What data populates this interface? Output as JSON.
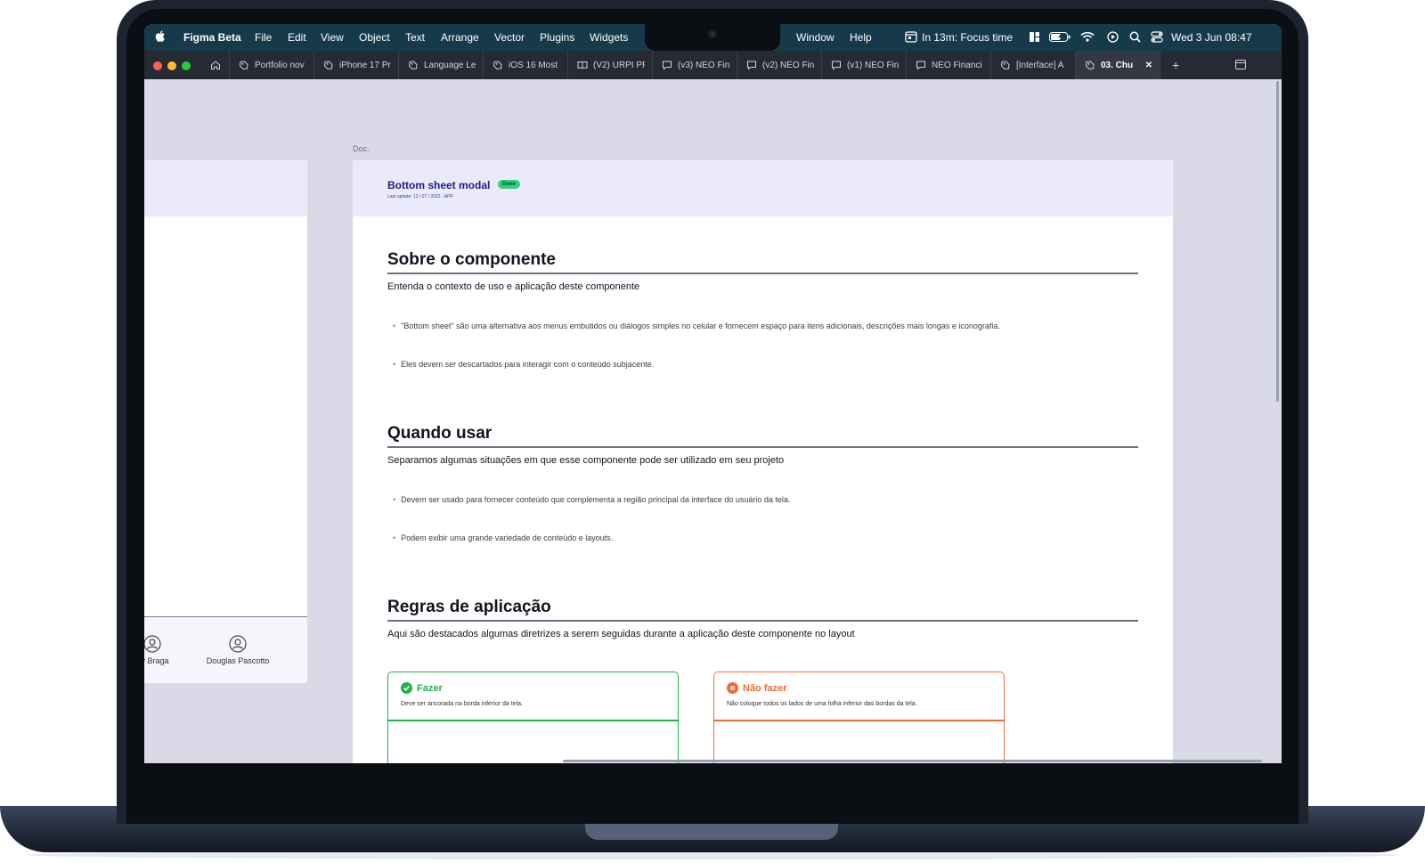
{
  "menubar": {
    "app_name": "Figma Beta",
    "items": [
      "File",
      "Edit",
      "View",
      "Object",
      "Text",
      "Arrange",
      "Vector",
      "Plugins",
      "Widgets"
    ],
    "right_items": [
      "Window",
      "Help"
    ],
    "focus_text": "In 13m: Focus time",
    "datetime": "Wed 3 Jun  08:47"
  },
  "tabs": [
    {
      "label": "Portfolio nov",
      "icon": "figma-file-icon"
    },
    {
      "label": "iPhone 17 Pr",
      "icon": "figma-file-icon"
    },
    {
      "label": "Language Le",
      "icon": "figma-file-icon"
    },
    {
      "label": "iOS 16 Most",
      "icon": "figma-file-icon"
    },
    {
      "label": "(V2) URPI PF",
      "icon": "book-icon"
    },
    {
      "label": "(v3) NEO Fin",
      "icon": "comment-icon"
    },
    {
      "label": "(v2) NEO Fin",
      "icon": "comment-icon"
    },
    {
      "label": "(v1) NEO Fin",
      "icon": "comment-icon"
    },
    {
      "label": "NEO Financi",
      "icon": "comment-icon"
    },
    {
      "label": "[Interface] A",
      "icon": "figma-file-icon"
    },
    {
      "label": "03. Chu",
      "icon": "figma-file-icon",
      "active": true
    }
  ],
  "left_card": {
    "people": [
      "rry Braga",
      "Douglas Pascotto"
    ]
  },
  "doc": {
    "label": "Doc.",
    "title": "Bottom sheet modal",
    "badge": "Done",
    "subtitle": "Last update: 12 / 07 / 2022 - APP",
    "sections": [
      {
        "heading": "Sobre o componente",
        "lead": "Entenda o contexto de uso e aplicação deste componente",
        "bullets": [
          "\"Bottom sheet\" são uma alternativa aos menus embutidos ou diálogos simples no celular e fornecem espaço para itens adicionais, descrições mais longas e iconografia.",
          "Eles devem ser descartados para interagir com o conteúdo subjacente."
        ]
      },
      {
        "heading": "Quando usar",
        "lead": "Separamos algumas situações em que esse componente pode ser utilizado em seu projeto",
        "bullets": [
          "Devem ser usado para fornecer conteúdo que complementa a região principal da interface do usuário da tela.",
          "Podem exibir uma grande variedade de conteúdo e layouts."
        ]
      },
      {
        "heading": "Regras de aplicação",
        "lead": "Aqui são destacados algumas diretrizes a serem seguidas durante a aplicação deste componente no layout"
      }
    ],
    "do_card": {
      "title": "Fazer",
      "desc": "Deve ser ancorada na borda inferior da tela.",
      "color": "#22b24c"
    },
    "dont_card": {
      "title": "Não fazer",
      "desc": "Não coloque todos os lados de uma folha inferior das bordas da tela.",
      "color": "#ef6a35"
    }
  },
  "colors": {
    "menubar": "#173a4b",
    "tabbar": "#262a33",
    "canvas": "#d9d9e8",
    "doc_title": "#1a1f8c",
    "badge": "#2fd27a"
  }
}
